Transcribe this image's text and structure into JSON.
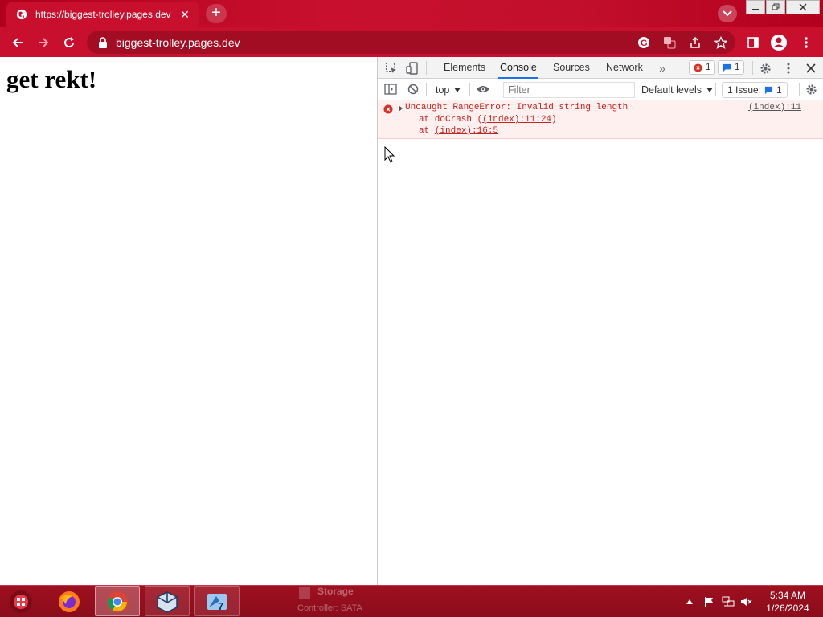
{
  "browser": {
    "tab_title": "https://biggest-trolley.pages.dev",
    "address": "biggest-trolley.pages.dev",
    "theme_color": "#c8102e"
  },
  "page": {
    "heading": "get rekt!"
  },
  "devtools": {
    "tabs": [
      "Elements",
      "Console",
      "Sources",
      "Network"
    ],
    "active_tab": "Console",
    "error_count": "1",
    "message_count": "1",
    "context": "top",
    "filter_placeholder": "Filter",
    "levels": "Default levels",
    "issues_label": "1 Issue:",
    "issues_count": "1",
    "console": {
      "error_text": "Uncaught RangeError: Invalid string length",
      "error_source": "(index):11",
      "stack_1_prefix": "at doCrash (",
      "stack_1_link": "(index):11:24",
      "stack_1_suffix": ")",
      "stack_2_prefix": "at ",
      "stack_2_link": "(index):16:5"
    }
  },
  "taskbar": {
    "ghost_title": "Storage",
    "ghost_sub": "Controller: SATA",
    "time": "5:34 AM",
    "date": "1/26/2024"
  }
}
